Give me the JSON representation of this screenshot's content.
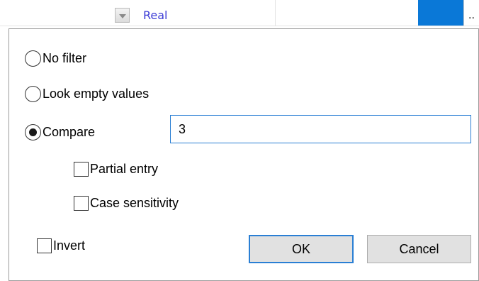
{
  "header": {
    "field_type": "Real",
    "ellipsis": "..",
    "swatch_color": "#0a78d7"
  },
  "dialog": {
    "options": {
      "no_filter": "No filter",
      "look_empty": "Look empty values",
      "compare": "Compare"
    },
    "selected_option": "compare",
    "compare_value": "3",
    "partial_entry": {
      "label": "Partial entry",
      "checked": false
    },
    "case_sensitivity": {
      "label": "Case sensitivity",
      "checked": false
    },
    "invert": {
      "label": "Invert",
      "checked": false
    },
    "ok_label": "OK",
    "cancel_label": "Cancel"
  }
}
